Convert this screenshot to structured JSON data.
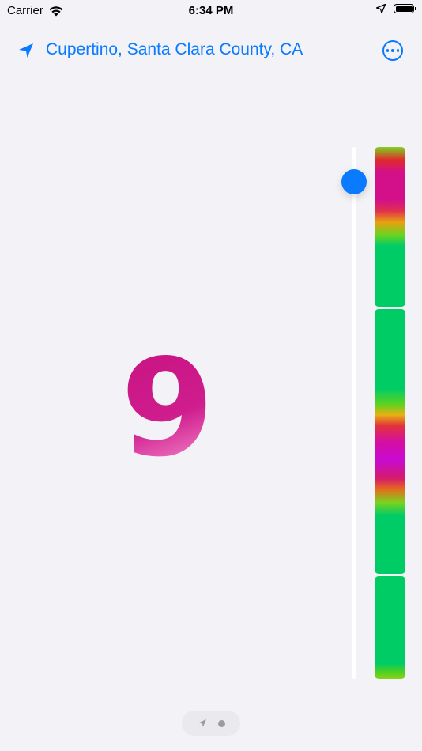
{
  "status_bar": {
    "carrier": "Carrier",
    "time": "6:34 PM"
  },
  "header": {
    "location": "Cupertino, Santa Clara County, CA"
  },
  "main": {
    "value": "9",
    "value_color": "#cc1b8c"
  },
  "slider": {
    "accent": "#0a7aff"
  },
  "page_control": {
    "pages": 2,
    "current": 2
  },
  "colors": {
    "accent": "#0a7aff",
    "background": "#f2f2f7",
    "green": "#00cc66",
    "magenta": "#d30f8a"
  }
}
